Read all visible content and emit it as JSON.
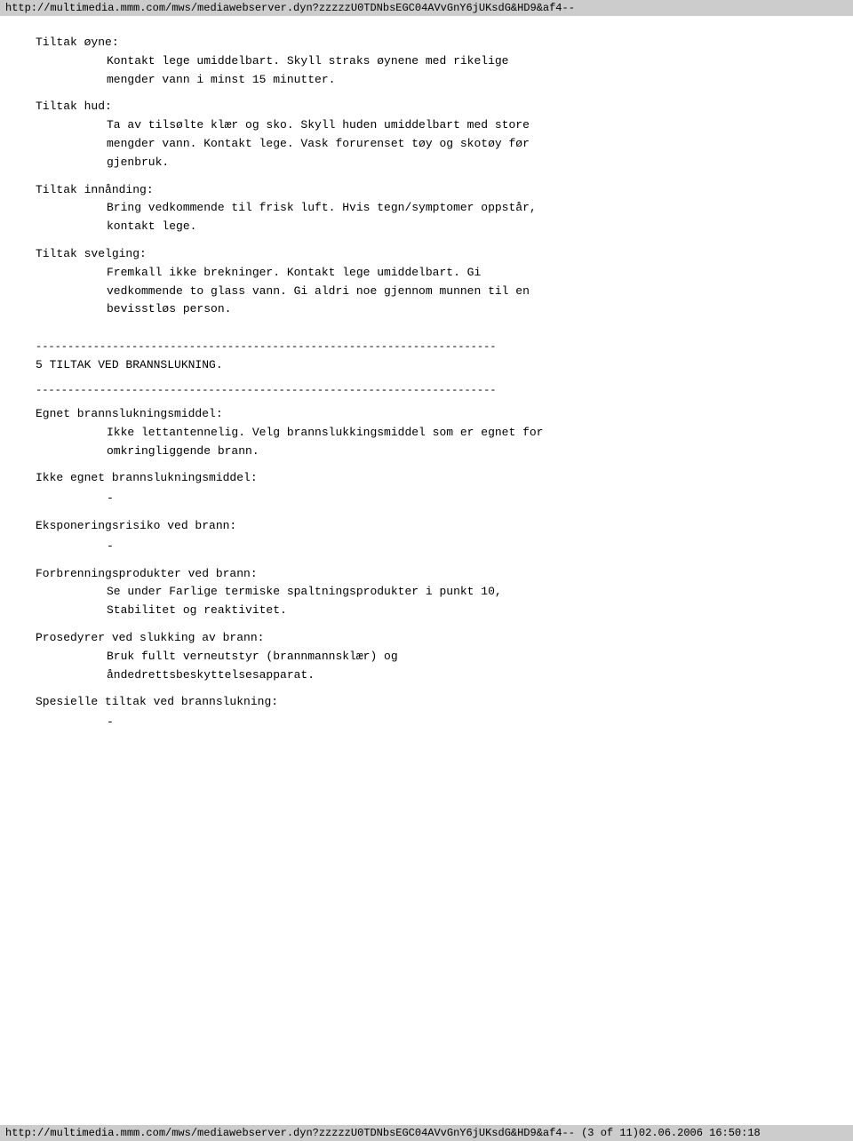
{
  "top_bar": {
    "url": "http://multimedia.mmm.com/mws/mediawebserver.dyn?zzzzzU0TDNbsEGC04AVvGnY6jUKsdG&HD9&af4--"
  },
  "bottom_bar": {
    "text": "http://multimedia.mmm.com/mws/mediawebserver.dyn?zzzzzU0TDNbsEGC04AVvGnY6jUKsdG&HD9&af4-- (3 of 11)02.06.2006 16:50:18"
  },
  "sections": {
    "tiltak_oyne_title": "Tiltak øyne:",
    "tiltak_oyne_line1": "Kontakt lege umiddelbart. Skyll straks øynene med rikelige",
    "tiltak_oyne_line2": "mengder vann i minst 15 minutter.",
    "tiltak_hud_title": "Tiltak hud:",
    "tiltak_hud_line1": "Ta av tilsølte klær og sko. Skyll huden umiddelbart med store",
    "tiltak_hud_line2": "mengder vann. Kontakt lege. Vask forurenset tøy og skotøy før",
    "tiltak_hud_line3": "gjenbruk.",
    "tiltak_innanding_title": "Tiltak innånding:",
    "tiltak_innanding_line1": "Bring vedkommende til frisk luft. Hvis tegn/symptomer oppstår,",
    "tiltak_innanding_line2": "kontakt lege.",
    "tiltak_svelging_title": "Tiltak svelging:",
    "tiltak_svelging_line1": "Fremkall ikke brekninger. Kontakt lege umiddelbart. Gi",
    "tiltak_svelging_line2": "vedkommende to glass vann. Gi aldri noe gjennom munnen til en",
    "tiltak_svelging_line3": "bevisstløs person.",
    "divider1": "------------------------------------------------------------------------",
    "section5_title": "5 TILTAK VED BRANNSLUKNING.",
    "divider2": "------------------------------------------------------------------------",
    "egnet_title": "Egnet brannslukningsmiddel:",
    "egnet_line1": "Ikke lettantennelig. Velg brannslukkingsmiddel som er egnet for",
    "egnet_line2": "omkringliggende brann.",
    "ikke_egnet_title": "Ikke egnet brannslukningsmiddel:",
    "ikke_egnet_dash": "-",
    "eksponering_title": "Eksponeringsrisiko ved brann:",
    "eksponering_dash": "-",
    "forbrenning_title": "Forbrenningsprodukter ved brann:",
    "forbrenning_line1": "Se under Farlige termiske spaltningsprodukter i punkt 10,",
    "forbrenning_line2": "Stabilitet og reaktivitet.",
    "prosedyrer_title": "Prosedyrer ved slukking av brann:",
    "prosedyrer_line1": "Bruk fullt verneutstyr (brannmannsklær) og",
    "prosedyrer_line2": "åndedrettsbeskyttelsesapparat.",
    "spesielle_title": "Spesielle tiltak ved brannslukning:",
    "spesielle_dash": "-"
  }
}
